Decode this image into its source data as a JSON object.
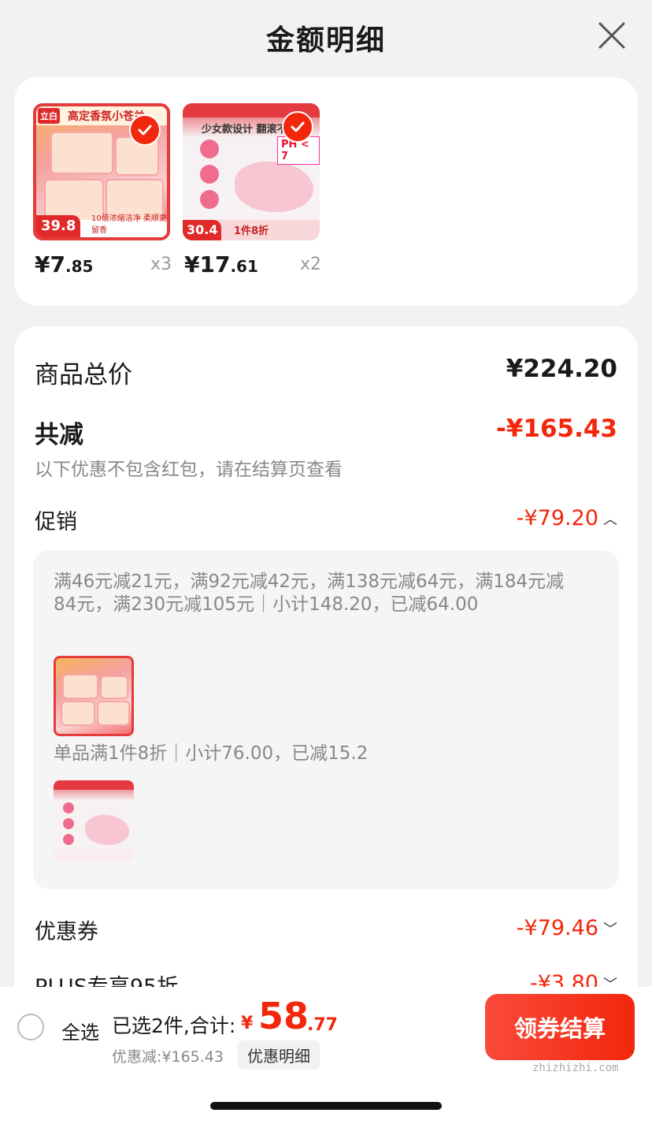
{
  "header": {
    "title": "金额明细"
  },
  "products": [
    {
      "price_int": "¥7",
      "price_dec": ".85",
      "qty": "x3",
      "tag_price": "39.8",
      "banner_text": "高定香氛小苍兰",
      "logo": "立白",
      "footer_text": "10倍浓缩洁净 柔顺更留香"
    },
    {
      "price_int": "¥17",
      "price_dec": ".61",
      "qty": "x2",
      "tag_price": "30.4",
      "sub_text": "少女款设计 翻滚不",
      "ph_text": "PH < 7",
      "bar_text": "1件8折"
    }
  ],
  "summary": {
    "goods_total_label": "商品总价",
    "goods_total_value": "¥224.20",
    "reduced_label": "共减",
    "reduced_value": "-¥165.43",
    "hint": "以下优惠不包含红包，请在结算页查看",
    "promo_label": "促销",
    "promo_value": "-¥79.20",
    "promo_rule_1": "满46元减21元，满92元减42元，满138元减64元，满184元减84元，满230元减105元｜小计148.20，已减64.00",
    "promo_rule_2": "单品满1件8折｜小计76.00，已减15.2",
    "coupon_label": "优惠券",
    "coupon_value": "-¥79.46",
    "plus_label": "PLUS专享95折",
    "plus_value": "-¥3.80"
  },
  "bottom": {
    "select_all": "全选",
    "selected_text": "已选2件,合计:",
    "currency": "¥",
    "total_int": "58",
    "total_dec": ".77",
    "saved_text": "优惠减:¥165.43",
    "detail_link": "优惠明细",
    "checkout": "领券结算",
    "watermark": "zhizhizhi.com"
  },
  "colors": {
    "accent": "#f2270c",
    "card": "#ffffff",
    "background": "#f2f2f2"
  }
}
